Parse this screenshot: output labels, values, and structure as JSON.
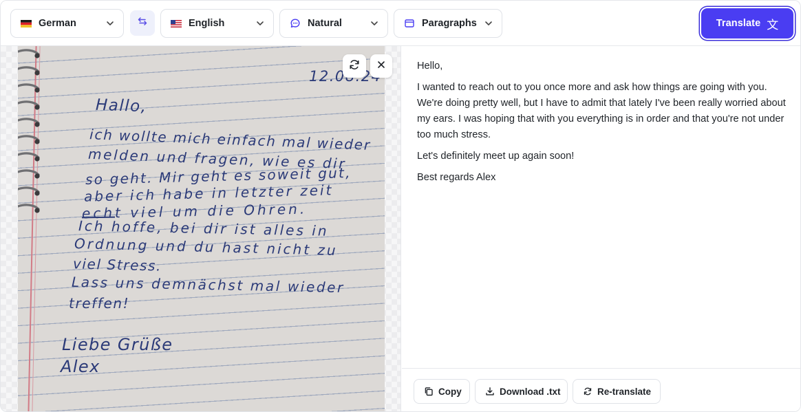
{
  "toolbar": {
    "source_language": {
      "label": "German",
      "flag": "de-flag-icon"
    },
    "target_language": {
      "label": "English",
      "flag": "us-flag-icon"
    },
    "tone": {
      "label": "Natural",
      "icon": "chat-bubble-icon"
    },
    "format": {
      "label": "Paragraphs",
      "icon": "window-icon"
    },
    "swap_icon": "swap-arrows-icon",
    "translate_label": "Translate",
    "translate_glyph": "文"
  },
  "image_pane": {
    "handwriting": {
      "date": "12.08.24",
      "lines": [
        "Hallo,",
        "ich wollte mich einfach mal wieder",
        "melden und fragen, wie es dir",
        "so geht. Mir geht es soweit gut,",
        "aber ich habe in letzter zeit",
        "echt viel um die Ohren.",
        "Ich hoffe, bei dir ist alles in",
        "Ordnung und du hast nicht zu",
        "viel Stress.",
        "Lass uns demnächst mal wieder",
        "treffen!",
        "Liebe Grüße",
        "Alex"
      ]
    },
    "tools": [
      "refresh-icon",
      "close-icon"
    ]
  },
  "translation": {
    "paragraphs": [
      "Hello,",
      "I wanted to reach out to you once more and ask how things are going with you. We're doing pretty well, but I have to admit that lately I've been really worried about my ears. I was hoping that with you everything is in order and that you're not under too much stress.",
      "Let's definitely meet up again soon!",
      "Best regards Alex"
    ]
  },
  "footer": {
    "copy_label": "Copy",
    "download_label": "Download .txt",
    "retranslate_label": "Re-translate"
  },
  "colors": {
    "accent": "#4a3df2",
    "ink": "#2b3a78",
    "border": "#dfe2e7"
  }
}
